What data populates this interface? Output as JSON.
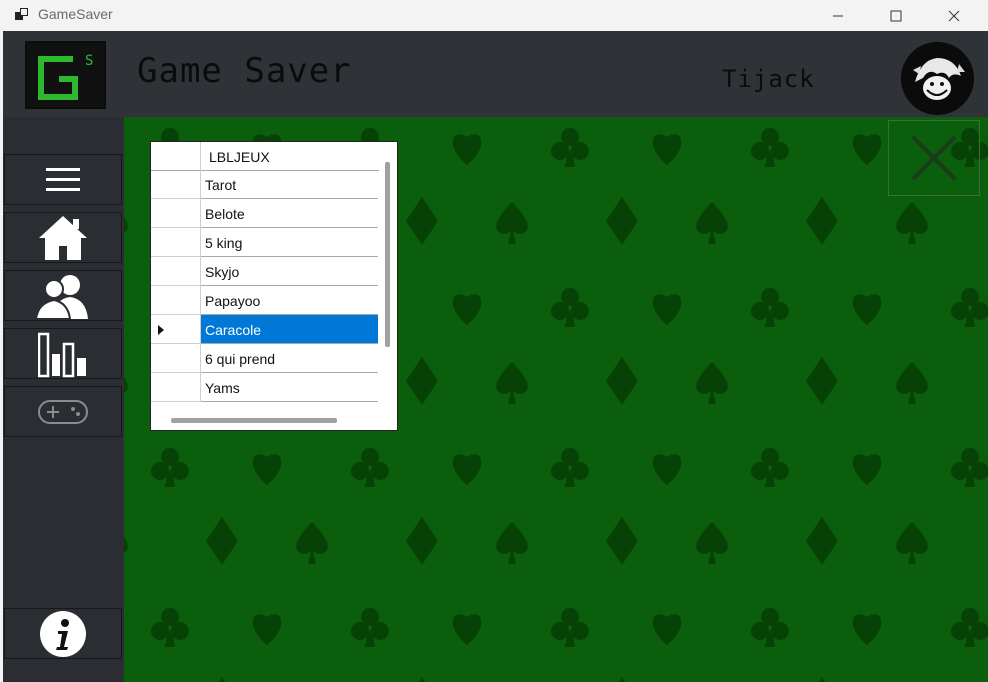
{
  "window": {
    "title": "GameSaver"
  },
  "header": {
    "app_title": "Game Saver",
    "user_name": "Tijack"
  },
  "sidebar": {
    "items": [
      {
        "name": "menu"
      },
      {
        "name": "home"
      },
      {
        "name": "users"
      },
      {
        "name": "stats"
      },
      {
        "name": "games"
      },
      {
        "name": "info"
      }
    ]
  },
  "grid": {
    "column_header": "LBLJEUX",
    "rows": [
      "Tarot",
      "Belote",
      "5 king",
      "Skyjo",
      "Papayoo",
      "Caracole",
      "6 qui prend",
      "Yams"
    ],
    "selected_index": 5
  },
  "colors": {
    "header_bg": "#2f3338",
    "sidebar_bg": "#2a2e33",
    "felt_green": "#0b5e0b",
    "suit_green": "#064206",
    "selection": "#0078d7",
    "logo_green": "#2db82d"
  }
}
